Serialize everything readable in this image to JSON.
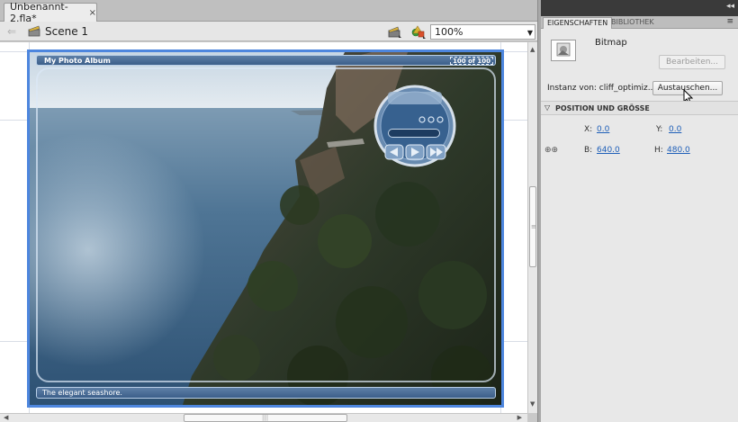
{
  "document": {
    "tab_title": "Unbenannt-2.fla*",
    "close_glyph": "×",
    "scene_label": "Scene 1",
    "zoom_value": "100%",
    "back_glyph": "⇐"
  },
  "stage": {
    "album_title": "My Photo Album",
    "counter": "100 of 100",
    "caption": "The elegant seashore."
  },
  "panel": {
    "tab_properties": "EIGENSCHAFTEN",
    "tab_library": "BIBLIOTHEK",
    "symbol_type": "Bitmap",
    "edit_button": "Bearbeiten...",
    "instance_label": "Instanz von: cliff_optimiz...",
    "swap_button": "Austauschen...",
    "section_title": "POSITION UND GRÖSSE",
    "x_label": "X:",
    "x_value": "0.0",
    "y_label": "Y:",
    "y_value": "0.0",
    "w_label": "B:",
    "w_value": "640.0",
    "h_label": "H:",
    "h_value": "480.0"
  },
  "icons": {
    "scene": "clapperboard-icon",
    "edit_symbols": "edit-symbols-icon",
    "lock": "link-proportions-icon"
  },
  "colors": {
    "frame_border": "#4d86de",
    "link_value": "#1f5fb8"
  }
}
